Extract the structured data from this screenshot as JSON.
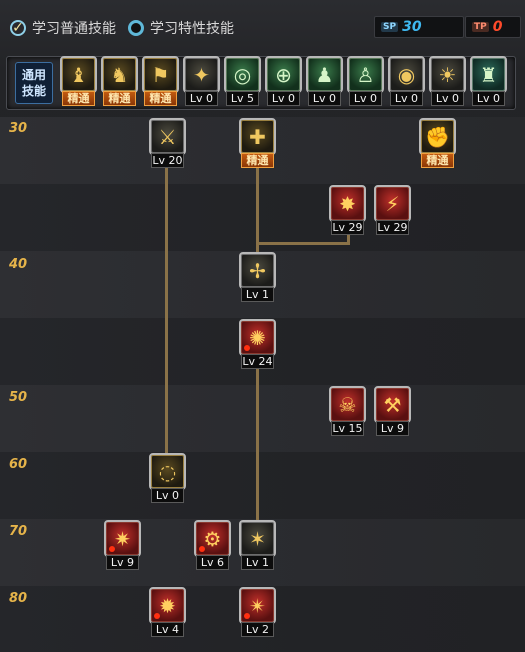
{
  "modes": {
    "normal_label": "学习普通技能",
    "special_label": "学习特性技能"
  },
  "counters": {
    "sp_tag": "SP",
    "sp_value": "30",
    "tp_tag": "TP",
    "tp_value": "0"
  },
  "common_skills": {
    "label_line1": "通用",
    "label_line2": "技能",
    "items": [
      {
        "badge": "精通",
        "mastered": true,
        "icon": "sitting-figure-icon",
        "glyph": "♝",
        "tone": "gold"
      },
      {
        "badge": "精通",
        "mastered": true,
        "icon": "leaping-figure-icon",
        "glyph": "♞",
        "tone": "gold"
      },
      {
        "badge": "精通",
        "mastered": true,
        "icon": "dash-figure-icon",
        "glyph": "⚑",
        "tone": "gold"
      },
      {
        "badge": "Lv 0",
        "mastered": false,
        "icon": "wings-icon",
        "glyph": "✦",
        "tone": "dark"
      },
      {
        "badge": "Lv 5",
        "mastered": false,
        "icon": "crosshair-icon",
        "glyph": "◎",
        "tone": "green"
      },
      {
        "badge": "Lv 0",
        "mastered": false,
        "icon": "target-scope-icon",
        "glyph": "⊕",
        "tone": "green"
      },
      {
        "badge": "Lv 0",
        "mastered": false,
        "icon": "kneeling-figure-icon",
        "glyph": "♟",
        "tone": "green"
      },
      {
        "badge": "Lv 0",
        "mastered": false,
        "icon": "crouching-figure-icon",
        "glyph": "♙",
        "tone": "green"
      },
      {
        "badge": "Lv 0",
        "mastered": false,
        "icon": "eye-swirl-icon",
        "glyph": "◉",
        "tone": "dark"
      },
      {
        "badge": "Lv 0",
        "mastered": false,
        "icon": "glowing-figure-icon",
        "glyph": "☀",
        "tone": "dark"
      },
      {
        "badge": "Lv 0",
        "mastered": false,
        "icon": "running-figure-icon",
        "glyph": "♜",
        "tone": "teal"
      }
    ]
  },
  "levels": [
    "30",
    "40",
    "50",
    "60",
    "70",
    "80"
  ],
  "tree_skills": [
    {
      "id": "s1",
      "badge": "Lv 20",
      "mastered": false,
      "icon": "claw-strike-icon",
      "glyph": "⚔",
      "tone": "dark",
      "red_dot": false
    },
    {
      "id": "s2",
      "badge": "精通",
      "mastered": true,
      "icon": "kick-icon",
      "glyph": "✚",
      "tone": "gold",
      "red_dot": false
    },
    {
      "id": "s3",
      "badge": "精通",
      "mastered": true,
      "icon": "fist-icon",
      "glyph": "✊",
      "tone": "gold",
      "red_dot": false
    },
    {
      "id": "s4",
      "badge": "Lv 29",
      "mastered": false,
      "icon": "explosion-icon",
      "glyph": "✸",
      "tone": "red",
      "red_dot": false
    },
    {
      "id": "s5",
      "badge": "Lv 29",
      "mastered": false,
      "icon": "blade-icon",
      "glyph": "⚡",
      "tone": "red",
      "red_dot": false
    },
    {
      "id": "s6",
      "badge": "Lv 1",
      "mastered": false,
      "icon": "scatter-shot-icon",
      "glyph": "✢",
      "tone": "dark",
      "red_dot": false
    },
    {
      "id": "s7",
      "badge": "Lv 24",
      "mastered": false,
      "icon": "flame-burst-icon",
      "glyph": "✺",
      "tone": "red",
      "red_dot": true
    },
    {
      "id": "s8",
      "badge": "Lv 15",
      "mastered": false,
      "icon": "skull-bomb-icon",
      "glyph": "☠",
      "tone": "red",
      "red_dot": false
    },
    {
      "id": "s9",
      "badge": "Lv 9",
      "mastered": false,
      "icon": "sword-slash-icon",
      "glyph": "⚒",
      "tone": "red",
      "red_dot": false
    },
    {
      "id": "s10",
      "badge": "Lv 0",
      "mastered": false,
      "icon": "whirlwind-icon",
      "glyph": "◌",
      "tone": "gold",
      "red_dot": false
    },
    {
      "id": "s11",
      "badge": "Lv 9",
      "mastered": false,
      "icon": "shotgun-icon",
      "glyph": "✷",
      "tone": "red",
      "red_dot": true
    },
    {
      "id": "s12",
      "badge": "Lv 6",
      "mastered": false,
      "icon": "gatling-icon",
      "glyph": "⚙",
      "tone": "red",
      "red_dot": true
    },
    {
      "id": "s13",
      "badge": "Lv 1",
      "mastered": false,
      "icon": "shard-burst-icon",
      "glyph": "✶",
      "tone": "dark",
      "red_dot": false
    },
    {
      "id": "s14",
      "badge": "Lv 4",
      "mastered": false,
      "icon": "rocket-volley-icon",
      "glyph": "✹",
      "tone": "red",
      "red_dot": true
    },
    {
      "id": "s15",
      "badge": "Lv 2",
      "mastered": false,
      "icon": "rising-blast-icon",
      "glyph": "✴",
      "tone": "red",
      "red_dot": true
    }
  ]
}
